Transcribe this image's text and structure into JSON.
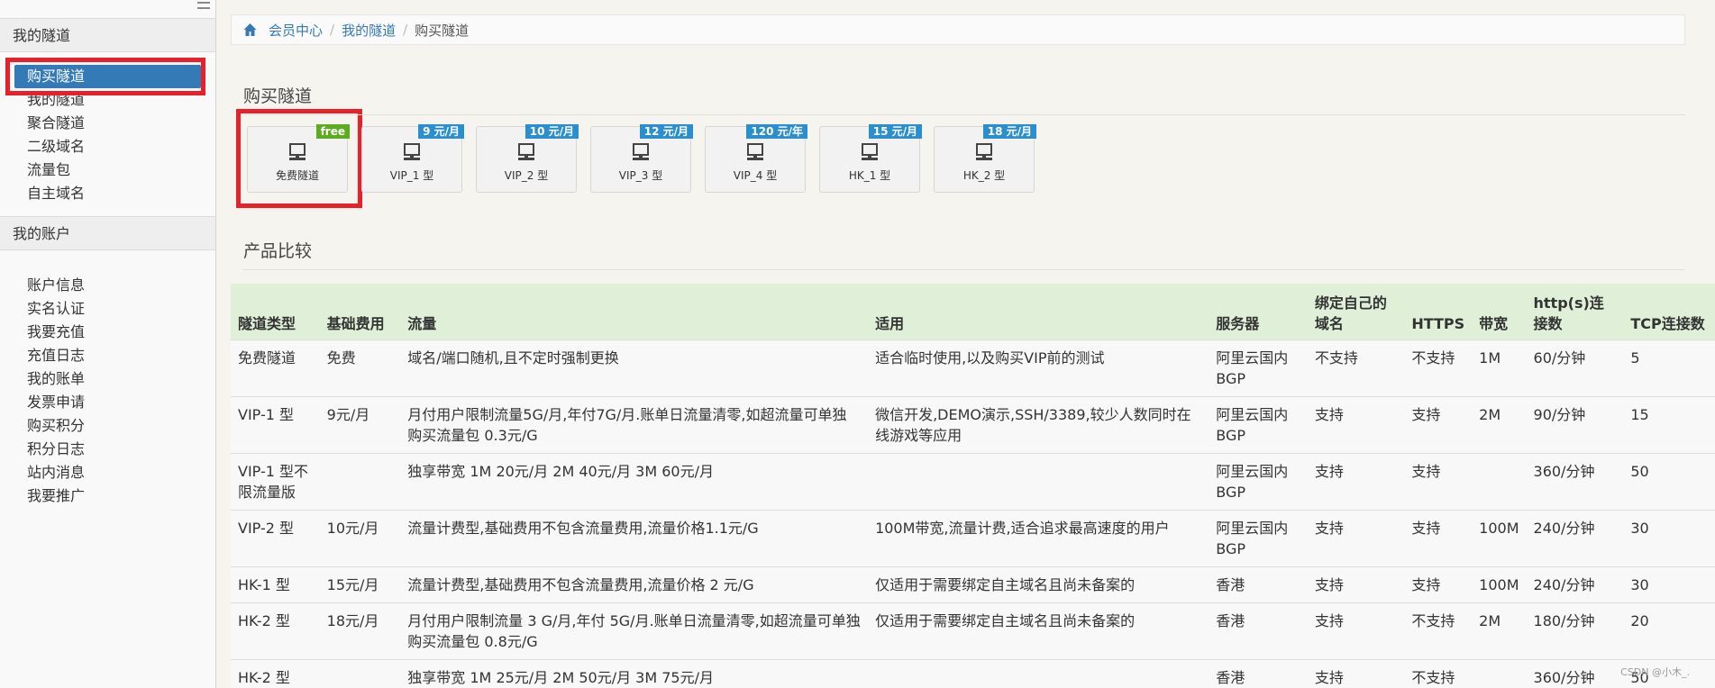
{
  "sidebar": {
    "section1_title": "我的隧道",
    "section1_items": [
      "购买隧道",
      "我的隧道",
      "聚合隧道",
      "二级域名",
      "流量包",
      "自主域名"
    ],
    "section2_title": "我的账户",
    "section2_items": [
      "账户信息",
      "实名认证",
      "我要充值",
      "充值日志",
      "我的账单",
      "发票申请",
      "购买积分",
      "积分日志",
      "站内消息",
      "我要推广"
    ]
  },
  "breadcrumb": {
    "items": [
      "会员中心",
      "我的隧道"
    ],
    "current": "购买隧道"
  },
  "buy_title": "购买隧道",
  "cards": [
    {
      "label": "免费隧道",
      "badge": "free"
    },
    {
      "label": "VIP_1 型",
      "badge": "9 元/月"
    },
    {
      "label": "VIP_2 型",
      "badge": "10 元/月"
    },
    {
      "label": "VIP_3 型",
      "badge": "12 元/月"
    },
    {
      "label": "VIP_4 型",
      "badge": "120 元/年"
    },
    {
      "label": "HK_1 型",
      "badge": "15 元/月"
    },
    {
      "label": "HK_2 型",
      "badge": "18 元/月"
    }
  ],
  "compare_title": "产品比较",
  "table": {
    "headers": [
      "隧道类型",
      "基础费用",
      "流量",
      "适用",
      "服务器",
      "绑定自己的域名",
      "HTTPS",
      "带宽",
      "http(s)连接数",
      "TCP连接数"
    ],
    "rows": [
      [
        "免费隧道",
        "免费",
        "域名/端口随机,且不定时强制更换",
        "适合临时使用,以及购买VIP前的测试",
        "阿里云国内BGP",
        "不支持",
        "不支持",
        "1M",
        "60/分钟",
        "5"
      ],
      [
        "VIP-1 型",
        "9元/月",
        "月付用户限制流量5G/月,年付7G/月.账单日流量清零,如超流量可单独购买流量包 0.3元/G",
        "微信开发,DEMO演示,SSH/3389,较少人数同时在线游戏等应用",
        "阿里云国内BGP",
        "支持",
        "支持",
        "2M",
        "90/分钟",
        "15"
      ],
      [
        "VIP-1 型不限流量版",
        "",
        "独享带宽 1M 20元/月 2M 40元/月 3M 60元/月",
        "",
        "阿里云国内BGP",
        "支持",
        "支持",
        "",
        "360/分钟",
        "50"
      ],
      [
        "VIP-2 型",
        "10元/月",
        "流量计费型,基础费用不包含流量费用,流量价格1.1元/G",
        "100M带宽,流量计费,适合追求最高速度的用户",
        "阿里云国内BGP",
        "支持",
        "支持",
        "100M",
        "240/分钟",
        "30"
      ],
      [
        "HK-1 型",
        "15元/月",
        "流量计费型,基础费用不包含流量费用,流量价格 2 元/G",
        "仅适用于需要绑定自主域名且尚未备案的",
        "香港",
        "支持",
        "支持",
        "100M",
        "240/分钟",
        "30"
      ],
      [
        "HK-2 型",
        "18元/月",
        "月付用户限制流量 3 G/月,年付 5G/月.账单日流量清零,如超流量可单独购买流量包 0.8元/G",
        "仅适用于需要绑定自主域名且尚未备案的",
        "香港",
        "支持",
        "不支持",
        "2M",
        "180/分钟",
        "20"
      ],
      [
        "HK-2 型",
        "",
        "独享带宽 1M 25元/月 2M 50元/月 3M 75元/月",
        "",
        "香港",
        "支持",
        "不支持",
        "",
        "360/分钟",
        "50"
      ]
    ]
  },
  "watermark": "CSDN @小木_.",
  "colors": {
    "accent": "#337ab7",
    "highlight": "#e8202a",
    "free_badge": "#5cac1f",
    "price_badge": "#2b8fcf",
    "table_header": "#dfefd8"
  }
}
